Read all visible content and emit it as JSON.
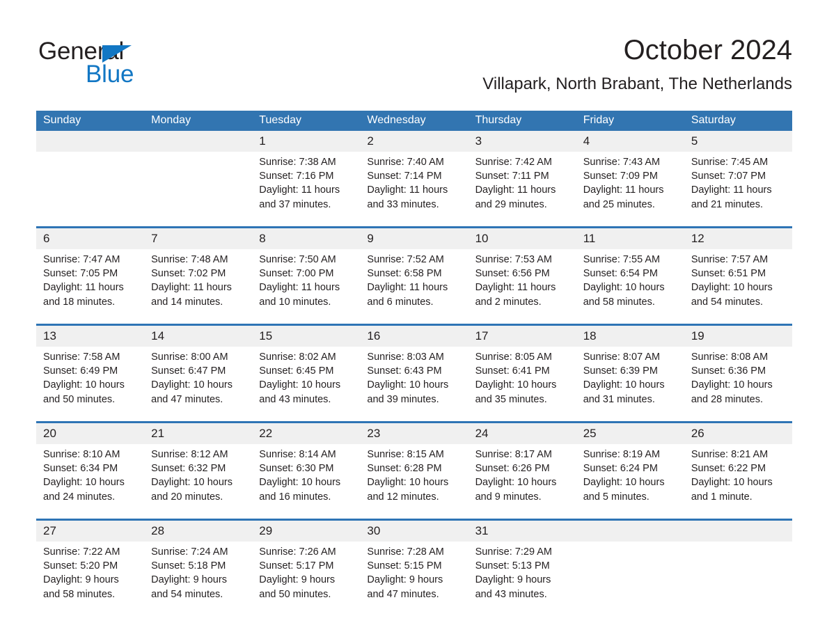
{
  "brand": {
    "name_part1": "General",
    "name_part2": "Blue",
    "accent_color": "#1277c4"
  },
  "header": {
    "title": "October 2024",
    "subtitle": "Villapark, North Brabant, The Netherlands"
  },
  "colors": {
    "header_blue": "#3275b1",
    "separator_blue": "#2e74b5",
    "daynum_band": "#f0f0f0",
    "text": "#231f20"
  },
  "weekdays": [
    "Sunday",
    "Monday",
    "Tuesday",
    "Wednesday",
    "Thursday",
    "Friday",
    "Saturday"
  ],
  "weeks": [
    {
      "days": [
        {
          "num": "",
          "l1": "",
          "l2": "",
          "l3": "",
          "l4": ""
        },
        {
          "num": "",
          "l1": "",
          "l2": "",
          "l3": "",
          "l4": ""
        },
        {
          "num": "1",
          "l1": "Sunrise: 7:38 AM",
          "l2": "Sunset: 7:16 PM",
          "l3": "Daylight: 11 hours",
          "l4": "and 37 minutes."
        },
        {
          "num": "2",
          "l1": "Sunrise: 7:40 AM",
          "l2": "Sunset: 7:14 PM",
          "l3": "Daylight: 11 hours",
          "l4": "and 33 minutes."
        },
        {
          "num": "3",
          "l1": "Sunrise: 7:42 AM",
          "l2": "Sunset: 7:11 PM",
          "l3": "Daylight: 11 hours",
          "l4": "and 29 minutes."
        },
        {
          "num": "4",
          "l1": "Sunrise: 7:43 AM",
          "l2": "Sunset: 7:09 PM",
          "l3": "Daylight: 11 hours",
          "l4": "and 25 minutes."
        },
        {
          "num": "5",
          "l1": "Sunrise: 7:45 AM",
          "l2": "Sunset: 7:07 PM",
          "l3": "Daylight: 11 hours",
          "l4": "and 21 minutes."
        }
      ]
    },
    {
      "days": [
        {
          "num": "6",
          "l1": "Sunrise: 7:47 AM",
          "l2": "Sunset: 7:05 PM",
          "l3": "Daylight: 11 hours",
          "l4": "and 18 minutes."
        },
        {
          "num": "7",
          "l1": "Sunrise: 7:48 AM",
          "l2": "Sunset: 7:02 PM",
          "l3": "Daylight: 11 hours",
          "l4": "and 14 minutes."
        },
        {
          "num": "8",
          "l1": "Sunrise: 7:50 AM",
          "l2": "Sunset: 7:00 PM",
          "l3": "Daylight: 11 hours",
          "l4": "and 10 minutes."
        },
        {
          "num": "9",
          "l1": "Sunrise: 7:52 AM",
          "l2": "Sunset: 6:58 PM",
          "l3": "Daylight: 11 hours",
          "l4": "and 6 minutes."
        },
        {
          "num": "10",
          "l1": "Sunrise: 7:53 AM",
          "l2": "Sunset: 6:56 PM",
          "l3": "Daylight: 11 hours",
          "l4": "and 2 minutes."
        },
        {
          "num": "11",
          "l1": "Sunrise: 7:55 AM",
          "l2": "Sunset: 6:54 PM",
          "l3": "Daylight: 10 hours",
          "l4": "and 58 minutes."
        },
        {
          "num": "12",
          "l1": "Sunrise: 7:57 AM",
          "l2": "Sunset: 6:51 PM",
          "l3": "Daylight: 10 hours",
          "l4": "and 54 minutes."
        }
      ]
    },
    {
      "days": [
        {
          "num": "13",
          "l1": "Sunrise: 7:58 AM",
          "l2": "Sunset: 6:49 PM",
          "l3": "Daylight: 10 hours",
          "l4": "and 50 minutes."
        },
        {
          "num": "14",
          "l1": "Sunrise: 8:00 AM",
          "l2": "Sunset: 6:47 PM",
          "l3": "Daylight: 10 hours",
          "l4": "and 47 minutes."
        },
        {
          "num": "15",
          "l1": "Sunrise: 8:02 AM",
          "l2": "Sunset: 6:45 PM",
          "l3": "Daylight: 10 hours",
          "l4": "and 43 minutes."
        },
        {
          "num": "16",
          "l1": "Sunrise: 8:03 AM",
          "l2": "Sunset: 6:43 PM",
          "l3": "Daylight: 10 hours",
          "l4": "and 39 minutes."
        },
        {
          "num": "17",
          "l1": "Sunrise: 8:05 AM",
          "l2": "Sunset: 6:41 PM",
          "l3": "Daylight: 10 hours",
          "l4": "and 35 minutes."
        },
        {
          "num": "18",
          "l1": "Sunrise: 8:07 AM",
          "l2": "Sunset: 6:39 PM",
          "l3": "Daylight: 10 hours",
          "l4": "and 31 minutes."
        },
        {
          "num": "19",
          "l1": "Sunrise: 8:08 AM",
          "l2": "Sunset: 6:36 PM",
          "l3": "Daylight: 10 hours",
          "l4": "and 28 minutes."
        }
      ]
    },
    {
      "days": [
        {
          "num": "20",
          "l1": "Sunrise: 8:10 AM",
          "l2": "Sunset: 6:34 PM",
          "l3": "Daylight: 10 hours",
          "l4": "and 24 minutes."
        },
        {
          "num": "21",
          "l1": "Sunrise: 8:12 AM",
          "l2": "Sunset: 6:32 PM",
          "l3": "Daylight: 10 hours",
          "l4": "and 20 minutes."
        },
        {
          "num": "22",
          "l1": "Sunrise: 8:14 AM",
          "l2": "Sunset: 6:30 PM",
          "l3": "Daylight: 10 hours",
          "l4": "and 16 minutes."
        },
        {
          "num": "23",
          "l1": "Sunrise: 8:15 AM",
          "l2": "Sunset: 6:28 PM",
          "l3": "Daylight: 10 hours",
          "l4": "and 12 minutes."
        },
        {
          "num": "24",
          "l1": "Sunrise: 8:17 AM",
          "l2": "Sunset: 6:26 PM",
          "l3": "Daylight: 10 hours",
          "l4": "and 9 minutes."
        },
        {
          "num": "25",
          "l1": "Sunrise: 8:19 AM",
          "l2": "Sunset: 6:24 PM",
          "l3": "Daylight: 10 hours",
          "l4": "and 5 minutes."
        },
        {
          "num": "26",
          "l1": "Sunrise: 8:21 AM",
          "l2": "Sunset: 6:22 PM",
          "l3": "Daylight: 10 hours",
          "l4": "and 1 minute."
        }
      ]
    },
    {
      "days": [
        {
          "num": "27",
          "l1": "Sunrise: 7:22 AM",
          "l2": "Sunset: 5:20 PM",
          "l3": "Daylight: 9 hours",
          "l4": "and 58 minutes."
        },
        {
          "num": "28",
          "l1": "Sunrise: 7:24 AM",
          "l2": "Sunset: 5:18 PM",
          "l3": "Daylight: 9 hours",
          "l4": "and 54 minutes."
        },
        {
          "num": "29",
          "l1": "Sunrise: 7:26 AM",
          "l2": "Sunset: 5:17 PM",
          "l3": "Daylight: 9 hours",
          "l4": "and 50 minutes."
        },
        {
          "num": "30",
          "l1": "Sunrise: 7:28 AM",
          "l2": "Sunset: 5:15 PM",
          "l3": "Daylight: 9 hours",
          "l4": "and 47 minutes."
        },
        {
          "num": "31",
          "l1": "Sunrise: 7:29 AM",
          "l2": "Sunset: 5:13 PM",
          "l3": "Daylight: 9 hours",
          "l4": "and 43 minutes."
        },
        {
          "num": "",
          "l1": "",
          "l2": "",
          "l3": "",
          "l4": ""
        },
        {
          "num": "",
          "l1": "",
          "l2": "",
          "l3": "",
          "l4": ""
        }
      ]
    }
  ]
}
